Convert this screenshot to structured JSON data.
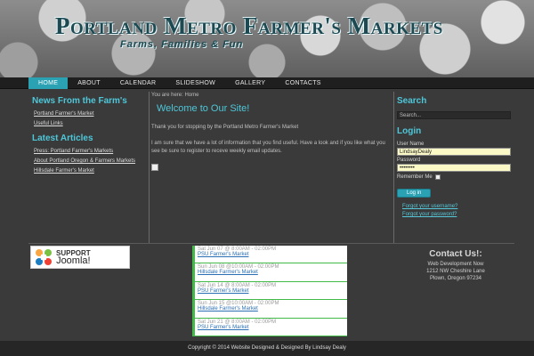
{
  "header": {
    "title": "Portland Metro Farmer's Markets",
    "tagline": "Farms, Families & Fun"
  },
  "nav": {
    "items": [
      "HOME",
      "ABOUT",
      "CALENDAR",
      "SLIDESHOW",
      "GALLERY",
      "CONTACTS"
    ],
    "active": "HOME"
  },
  "left": {
    "news_heading": "News From the Farm's",
    "news_links": [
      "Portland Farmer's Market",
      "Useful Links"
    ],
    "articles_heading": "Latest Articles",
    "article_links": [
      "Press: Portland Farmer's Markets",
      "About Portland Oregon & Farmers Markets",
      "Hillsdale Farmer's Market"
    ]
  },
  "main": {
    "breadcrumb": "You are here:  Home",
    "heading": "Welcome to Our Site!",
    "para1": "Thank you for stopping by the Portland Metro Farmer's Market",
    "para2": "I am sure that we have a lot of information that you find useful.  Have a look and if you like what you see be sure to register to receve weekly email updates."
  },
  "right": {
    "search_heading": "Search",
    "search_value": "Search...",
    "login_heading": "Login",
    "username_label": "User Name",
    "username_value": "LindsayDealy",
    "password_label": "Password",
    "password_value": "••••••••",
    "remember_label": "Remember Me",
    "login_button": "Log in",
    "forgot_username": "Forgot your username?",
    "forgot_password": "Forgot your password?"
  },
  "support": {
    "line1": "SUPPORT",
    "line2": "Joomla!"
  },
  "events": [
    {
      "date": "Sat Jun 07 @ 8:00AM - 02:00PM",
      "link": "PSU Farmer's Market"
    },
    {
      "date": "Sun Jun 08 @10:00AM - 02:00PM",
      "link": "Hillsdale Farmer's Market"
    },
    {
      "date": "Sat Jun 14 @ 8:00AM - 02:00PM",
      "link": "PSU Farmer's Market"
    },
    {
      "date": "Sun Jun 15 @10:00AM - 02:00PM",
      "link": "Hillsdale Farmer's Market"
    },
    {
      "date": "Sat Jun 21 @ 8:00AM - 02:00PM",
      "link": "PSU Farmer's Market"
    }
  ],
  "contact": {
    "title": "Contact Us!:",
    "lines": [
      "Web Development Now",
      "1212 NW Cheshire Lane",
      "Plown, Oregon 97234"
    ]
  },
  "footer": {
    "text": "Copyright © 2014 Website Designed & Designed By Lindsay Dealy"
  },
  "colors": {
    "accent": "#2aa2b4",
    "heading": "#4ec7d9",
    "event_border": "#43b94a"
  }
}
